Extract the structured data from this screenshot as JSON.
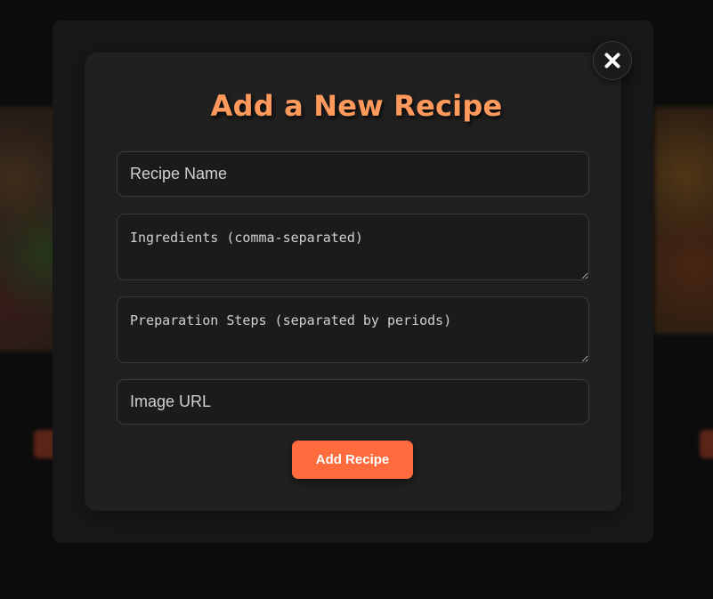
{
  "modal": {
    "title": "Add a New Recipe",
    "close_icon": "close-icon",
    "fields": {
      "recipe_name": {
        "placeholder": "Recipe Name",
        "value": ""
      },
      "ingredients": {
        "placeholder": "Ingredients (comma-separated)",
        "value": ""
      },
      "steps": {
        "placeholder": "Preparation Steps (separated by periods)",
        "value": ""
      },
      "image_url": {
        "placeholder": "Image URL",
        "value": ""
      }
    },
    "submit_label": "Add Recipe"
  },
  "colors": {
    "accent": "#ff6b3d",
    "title": "#ff9a5c",
    "modal_bg": "#202020",
    "backdrop": "#0c0c0c"
  }
}
